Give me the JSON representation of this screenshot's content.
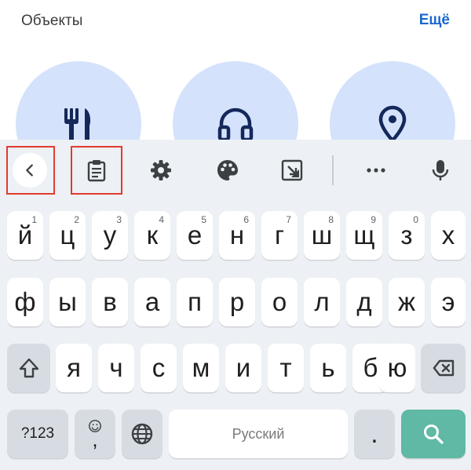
{
  "header": {
    "title": "Объекты",
    "more_label": "Ещё"
  },
  "categories": [
    {
      "icon": "restaurant-icon"
    },
    {
      "icon": "headphones-icon"
    },
    {
      "icon": "location-pin-icon"
    }
  ],
  "toolbar": {
    "items": [
      "back-icon",
      "clipboard-icon",
      "gear-icon",
      "palette-icon",
      "resize-icon",
      "more-dots-icon",
      "mic-icon"
    ],
    "highlight_color": "#e23b2f"
  },
  "keyboard": {
    "row1": [
      {
        "label": "й",
        "hint": "1"
      },
      {
        "label": "ц",
        "hint": "2"
      },
      {
        "label": "у",
        "hint": "3"
      },
      {
        "label": "к",
        "hint": "4"
      },
      {
        "label": "е",
        "hint": "5"
      },
      {
        "label": "н",
        "hint": "6"
      },
      {
        "label": "г",
        "hint": "7"
      },
      {
        "label": "ш",
        "hint": "8"
      },
      {
        "label": "щ",
        "hint": "9"
      },
      {
        "label": "з",
        "hint": "0"
      },
      {
        "label": "х",
        "hint": ""
      }
    ],
    "row2": [
      "ф",
      "ы",
      "в",
      "а",
      "п",
      "р",
      "о",
      "л",
      "д",
      "ж",
      "э"
    ],
    "row3": [
      "я",
      "ч",
      "с",
      "м",
      "и",
      "т",
      "ь",
      "б",
      "ю"
    ],
    "symbols_label": "?123",
    "emoji_comma": ",",
    "space_label": "Русский",
    "period_label": ".",
    "accent_color": "#5fb9a4"
  }
}
